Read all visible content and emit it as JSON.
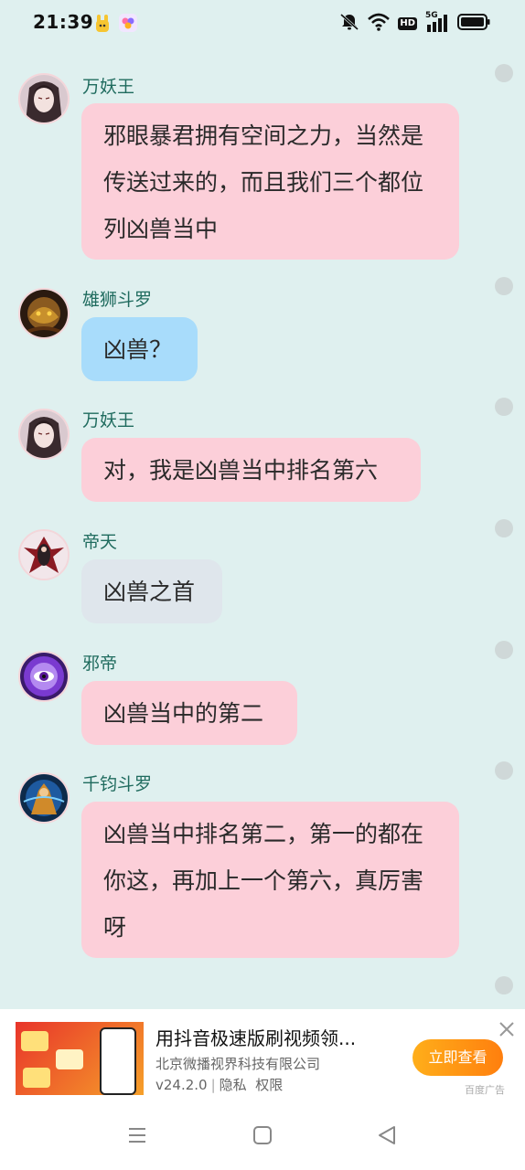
{
  "status_bar": {
    "time": "21:39",
    "hd": "HD",
    "network": "5G",
    "icons": [
      "app-bunny-icon",
      "app-pinwheel-icon",
      "mute-bell-icon",
      "wifi-icon",
      "signal-icon",
      "battery-icon"
    ]
  },
  "messages": [
    {
      "sender": "万妖王",
      "text": "邪眼暴君拥有空间之力，当然是传送过来的，而且我们三个都位列凶兽当中",
      "bubble_color": "#fccfd9",
      "avatar": "long-hair-warrior-avatar"
    },
    {
      "sender": "雄狮斗罗",
      "text": "凶兽？",
      "bubble_color": "#a8dcfb",
      "avatar": "golden-lion-avatar"
    },
    {
      "sender": "万妖王",
      "text": "对，我是凶兽当中排名第六",
      "bubble_color": "#fccfd9",
      "avatar": "long-hair-warrior-avatar"
    },
    {
      "sender": "帝天",
      "text": "凶兽之首",
      "bubble_color": "#dfe6ec",
      "avatar": "dark-dragon-avatar"
    },
    {
      "sender": "邪帝",
      "text": "凶兽当中的第二",
      "bubble_color": "#fccfd9",
      "avatar": "purple-eye-avatar"
    },
    {
      "sender": "千钧斗罗",
      "text": "凶兽当中排名第二，第一的都在你这，再加上一个第六，真厉害呀",
      "bubble_color": "#fccfd9",
      "avatar": "blue-warrior-avatar"
    }
  ],
  "ad": {
    "title": "用抖音极速版刷视频领...",
    "company": "北京微播视界科技有限公司",
    "version": "v24.2.0",
    "privacy": "隐私",
    "permissions": "权限",
    "cta": "立即查看",
    "source": "百度广告"
  },
  "nav": {
    "buttons": [
      "menu-icon",
      "home-icon",
      "back-icon"
    ]
  }
}
